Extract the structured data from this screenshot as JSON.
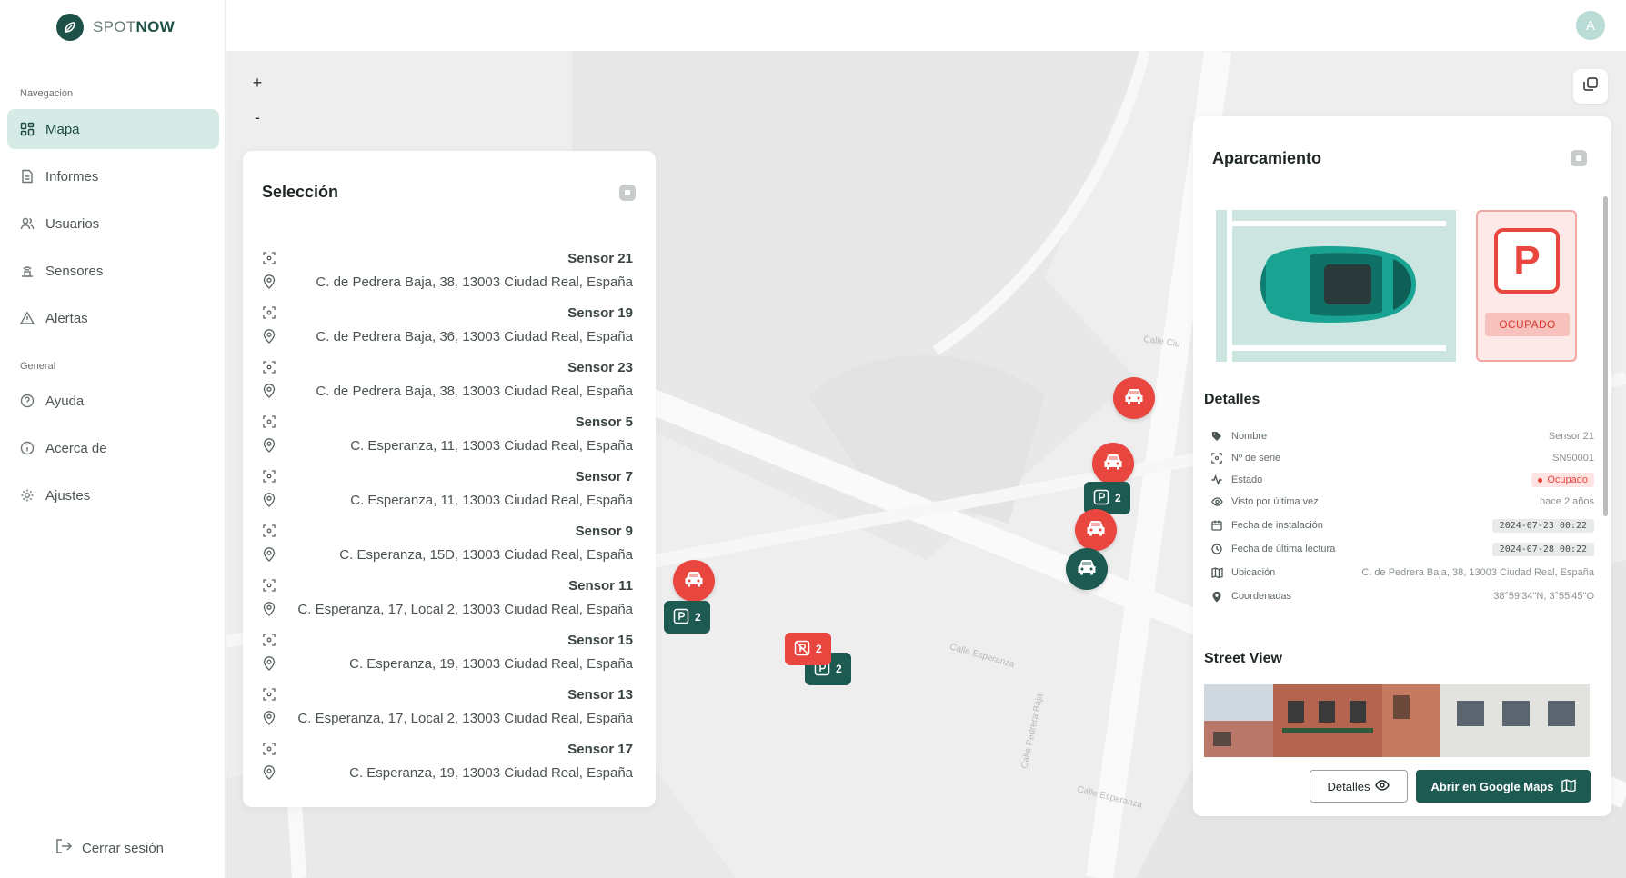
{
  "app": {
    "brand_light": "SPOT",
    "brand_bold": "NOW",
    "user_initial": "A"
  },
  "sidebar": {
    "nav_heading": "Navegación",
    "general_heading": "General",
    "items": [
      {
        "label": "Mapa",
        "icon": "grid-icon",
        "active": true
      },
      {
        "label": "Informes",
        "icon": "document-icon"
      },
      {
        "label": "Usuarios",
        "icon": "users-icon"
      },
      {
        "label": "Sensores",
        "icon": "sensor-icon"
      },
      {
        "label": "Alertas",
        "icon": "alert-triangle-icon"
      }
    ],
    "general_items": [
      {
        "label": "Ayuda",
        "icon": "help-circle-icon"
      },
      {
        "label": "Acerca de",
        "icon": "info-icon"
      },
      {
        "label": "Ajustes",
        "icon": "gear-icon"
      }
    ],
    "logout": "Cerrar sesión"
  },
  "map": {
    "zoom_in": "+",
    "zoom_out": "-",
    "clusters": [
      {
        "count": "2"
      },
      {
        "count": "2"
      },
      {
        "count": "2"
      },
      {
        "count": "2"
      }
    ]
  },
  "selection": {
    "title": "Selección",
    "rows": [
      {
        "name": "Sensor 21",
        "address": "C. de Pedrera Baja, 38, 13003 Ciudad Real, España"
      },
      {
        "name": "Sensor 19",
        "address": "C. de Pedrera Baja, 36, 13003 Ciudad Real, España"
      },
      {
        "name": "Sensor 23",
        "address": "C. de Pedrera Baja, 38, 13003 Ciudad Real, España"
      },
      {
        "name": "Sensor 5",
        "address": "C. Esperanza, 11, 13003 Ciudad Real, España"
      },
      {
        "name": "Sensor 7",
        "address": "C. Esperanza, 11, 13003 Ciudad Real, España"
      },
      {
        "name": "Sensor 9",
        "address": "C. Esperanza, 15D, 13003 Ciudad Real, España"
      },
      {
        "name": "Sensor 11",
        "address": "C. Esperanza, 17, Local 2, 13003 Ciudad Real, España"
      },
      {
        "name": "Sensor 15",
        "address": "C. Esperanza, 19, 13003 Ciudad Real, España"
      },
      {
        "name": "Sensor 13",
        "address": "C. Esperanza, 17, Local 2, 13003 Ciudad Real, España"
      },
      {
        "name": "Sensor 17",
        "address": "C. Esperanza, 19, 13003 Ciudad Real, España"
      }
    ]
  },
  "parking": {
    "title": "Aparcamiento",
    "status_letter": "P",
    "status_label": "OCUPADO",
    "details_title": "Detalles",
    "details": {
      "name_label": "Nombre",
      "name_value": "Sensor 21",
      "serial_label": "Nº de serie",
      "serial_value": "SN90001",
      "state_label": "Estado",
      "state_value": "Ocupado",
      "seen_label": "Visto por última vez",
      "seen_value": "hace 2 años",
      "install_label": "Fecha de instalación",
      "install_value": "2024-07-23 00:22",
      "read_label": "Fecha de última lectura",
      "read_value": "2024-07-28 00:22",
      "location_label": "Ubicación",
      "location_value": "C. de Pedrera Baja, 38, 13003 Ciudad Real, España",
      "coords_label": "Coordenadas",
      "coords_value": "38°59'34\"N, 3°55'45\"O"
    },
    "street_view_title": "Street View",
    "btn_details": "Detalles",
    "btn_maps": "Abrir en Google Maps"
  },
  "colors": {
    "brand": "#1d5a52",
    "occupied": "#e9463f",
    "active_nav": "#d6ebe6"
  }
}
